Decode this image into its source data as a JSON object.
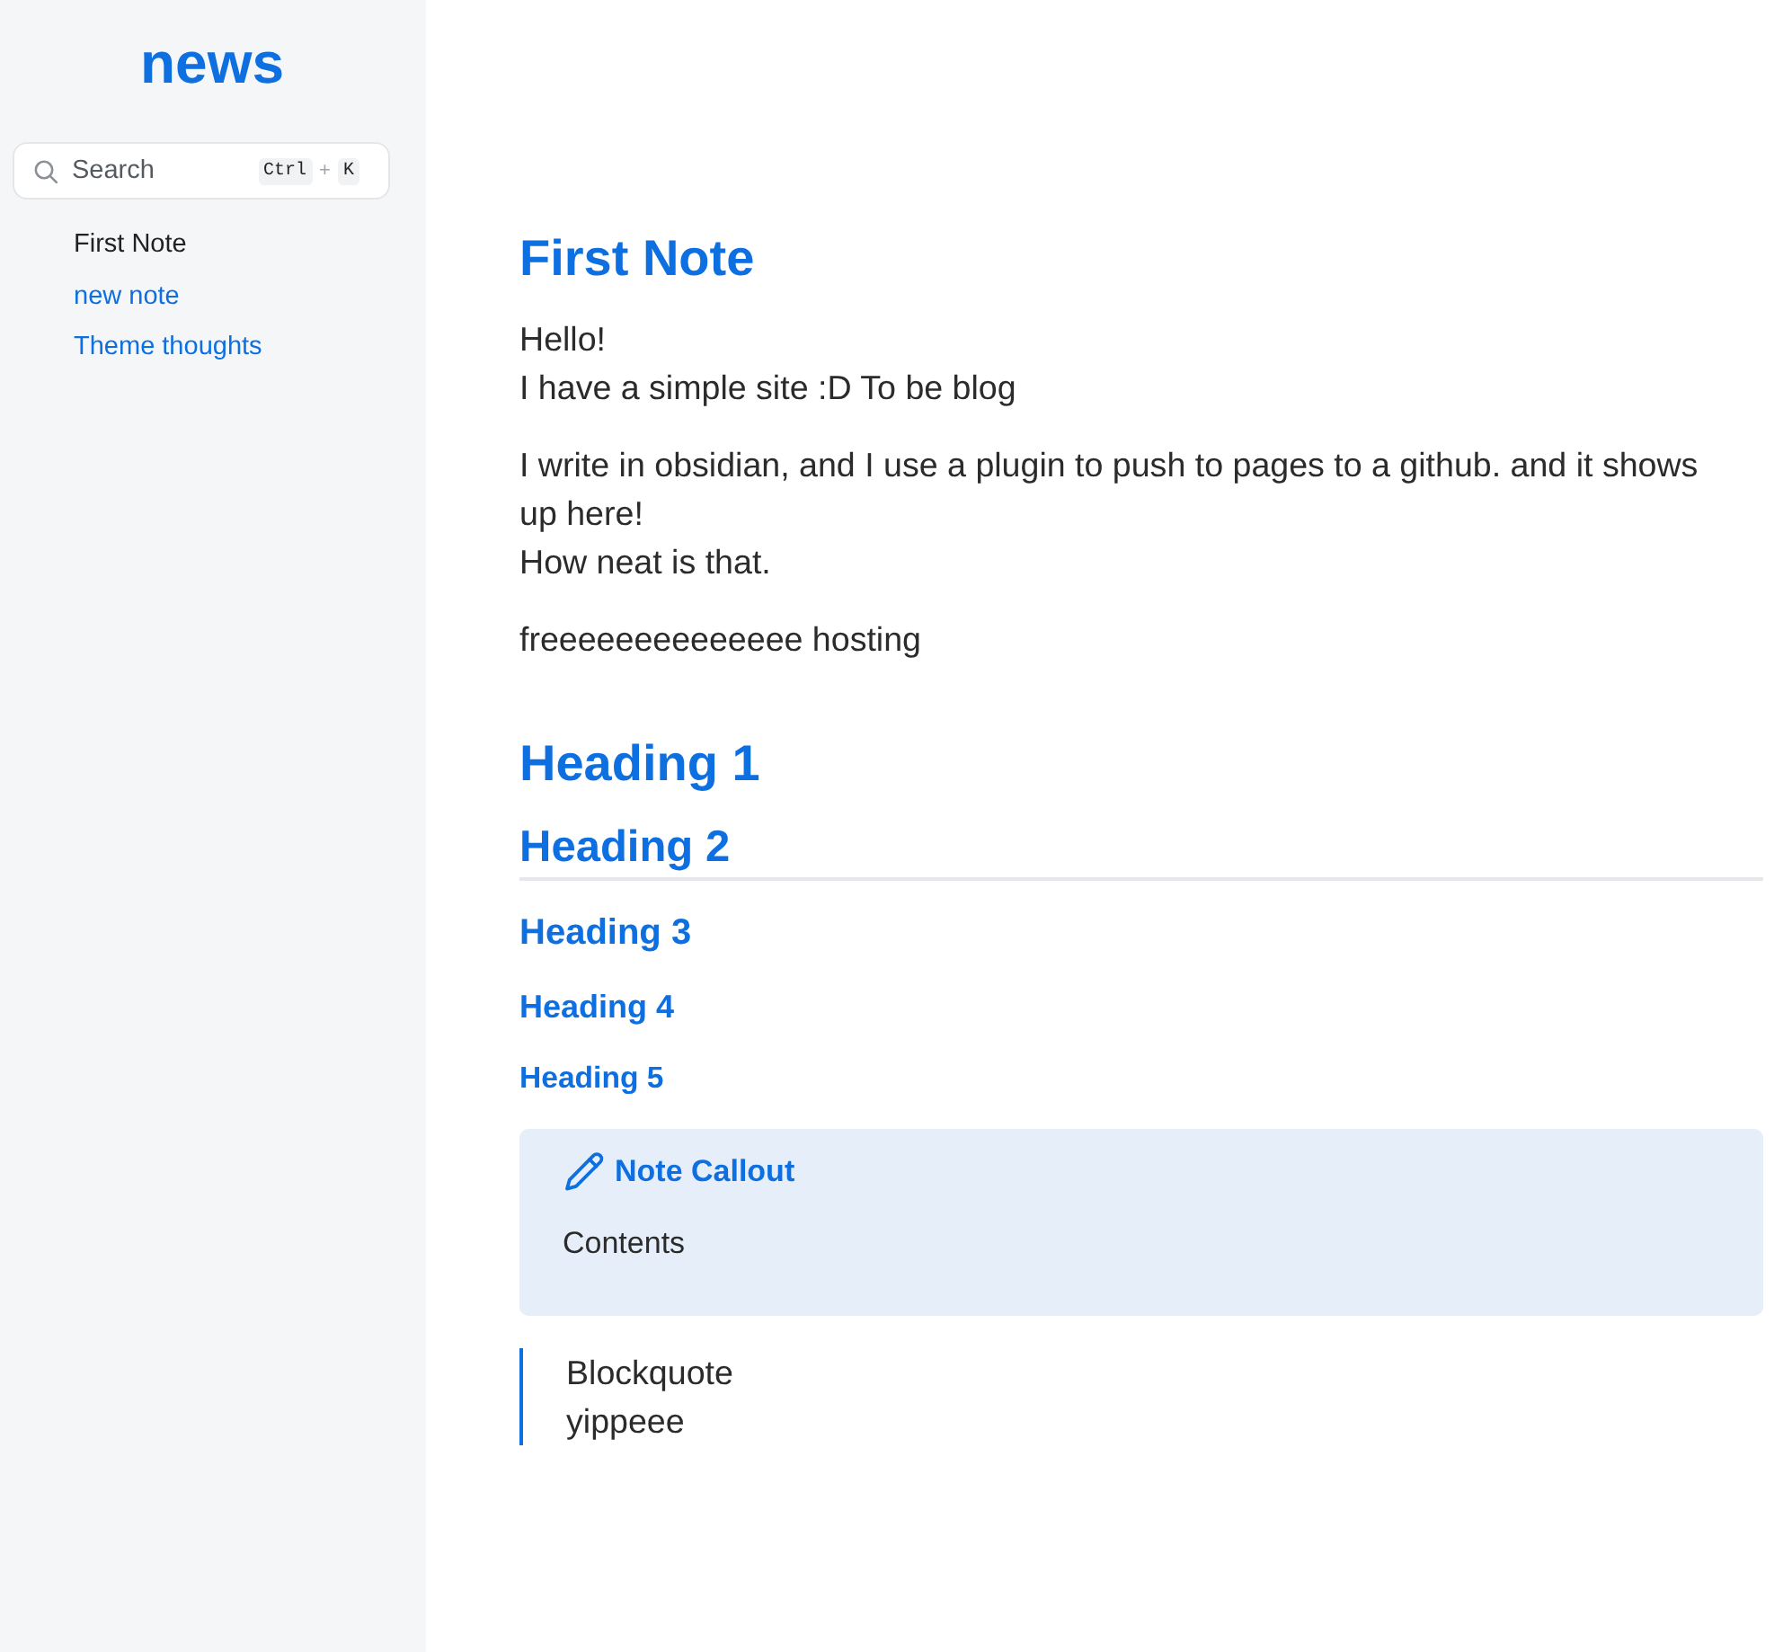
{
  "sidebar": {
    "title": "news",
    "search": {
      "label": "Search",
      "shortcut": [
        {
          "kind": "key",
          "text": "Ctrl"
        },
        {
          "kind": "separator",
          "text": "+"
        },
        {
          "kind": "key",
          "text": "K"
        }
      ]
    },
    "nav": [
      {
        "label": "First Note",
        "selected": true
      },
      {
        "label": "new note",
        "selected": false
      },
      {
        "label": "Theme thoughts",
        "selected": false
      }
    ]
  },
  "article": {
    "title": "First Note",
    "blocks": [
      {
        "kind": "paragraph",
        "lines": [
          "Hello!",
          "I have a simple site :D To be blog"
        ]
      },
      {
        "kind": "paragraph",
        "lines": [
          "I write in obsidian, and I use a plugin to push to pages to a github. and it shows up here!",
          "How neat is that."
        ]
      },
      {
        "kind": "paragraph",
        "lines": [
          "freeeeeeeeeeeeee hosting"
        ]
      },
      {
        "kind": "h1",
        "text": "Heading 1"
      },
      {
        "kind": "h2",
        "text": "Heading 2"
      },
      {
        "kind": "h3",
        "text": "Heading 3"
      },
      {
        "kind": "h4",
        "text": "Heading 4"
      },
      {
        "kind": "h5",
        "text": "Heading 5"
      },
      {
        "kind": "callout",
        "title": "Note Callout",
        "body": "Contents"
      },
      {
        "kind": "blockquote",
        "lines": [
          "Blockquote",
          "yippeee"
        ]
      }
    ]
  }
}
